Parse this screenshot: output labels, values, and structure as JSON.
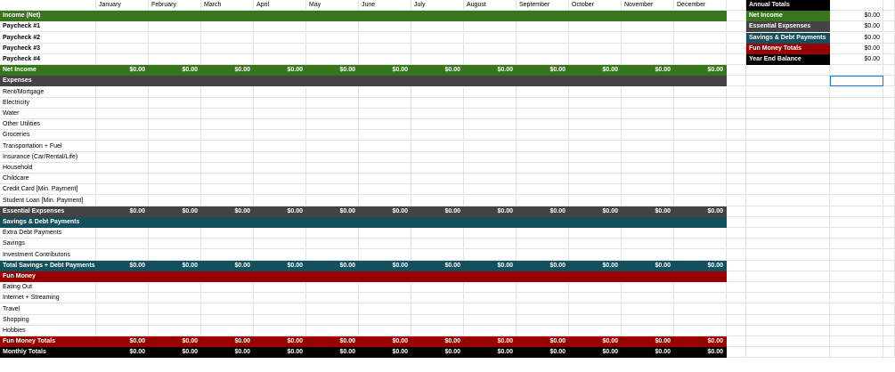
{
  "months": [
    "January",
    "February",
    "March",
    "April",
    "May",
    "June",
    "July",
    "August",
    "September",
    "October",
    "November",
    "December"
  ],
  "zero": "$0.00",
  "income": {
    "header": "Income (Net)",
    "items": [
      "Paycheck #1",
      "Paycheck #2",
      "Paycheck #3",
      "Paycheck #4"
    ],
    "total_label": "Net Income"
  },
  "expenses": {
    "header": "Expenses",
    "items": [
      "Rent/Mortgage",
      "Electricity",
      "Water",
      "Other Utilities",
      "Groceries",
      "Transportation + Fuel",
      "Insurance (Car/Rental/Life)",
      "Household",
      "Childcare",
      "Credit Card [Min. Payment]",
      "Student Loan [Min. Payment]"
    ],
    "total_label": "Essential Expsenses"
  },
  "savings": {
    "header": "Savings & Debt Payments",
    "items": [
      "Extra Debt Payments",
      "Savings",
      "Investment Contributons"
    ],
    "total_label": "Total Savings + Debt Payments"
  },
  "fun": {
    "header": "Fun Money",
    "items": [
      "Eating Out",
      "Internet + Streaming",
      "Travel",
      "Shopping",
      "Hobbies"
    ],
    "total_label": "Fun Money Totals"
  },
  "monthly_totals_label": "Monthly Totals",
  "annual": {
    "header": "Annual Totals",
    "rows": [
      {
        "label": "Net Income",
        "value": "$0.00",
        "color": "#38761d"
      },
      {
        "label": "Essential Expsenses",
        "value": "$0.00",
        "color": "#434343"
      },
      {
        "label": "Savings & Debt Payments",
        "value": "$0.00",
        "color": "#134f5c"
      },
      {
        "label": "Fun Money Totals",
        "value": "$0.00",
        "color": "#990000"
      },
      {
        "label": "Year End Balance",
        "value": "$0.00",
        "color": "#000000"
      }
    ]
  },
  "colors": {
    "income": "#38761d",
    "expenses": "#434343",
    "savings": "#134f5c",
    "fun": "#990000",
    "totals": "#000000",
    "grid": "#e2e2e2",
    "selection": "#1a73e8"
  }
}
